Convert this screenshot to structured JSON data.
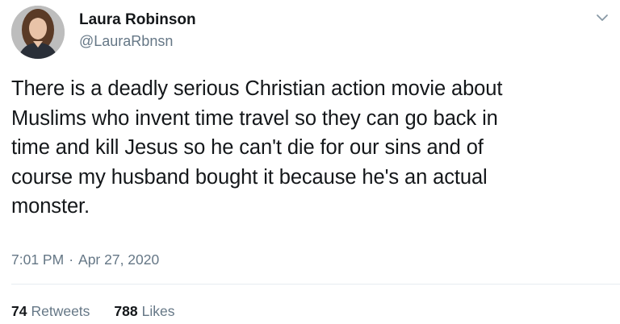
{
  "user": {
    "display_name": "Laura Robinson",
    "handle": "@LauraRbnsn",
    "avatar_icon": "profile-photo"
  },
  "tweet": {
    "text": "There is a deadly serious Christian action movie about\nMuslims who invent time travel so they can go back in\ntime and kill Jesus so he can't die for our sins and of\ncourse my husband bought it because he's an actual\nmonster.",
    "time": "7:01 PM",
    "separator": "·",
    "date": "Apr 27, 2020"
  },
  "stats": {
    "retweets_count": "74",
    "retweets_label": "Retweets",
    "likes_count": "788",
    "likes_label": "Likes"
  },
  "menu": {
    "icon": "chevron-down-icon"
  },
  "colors": {
    "text": "#14171a",
    "secondary": "#657786",
    "divider": "#e6ecf0"
  }
}
